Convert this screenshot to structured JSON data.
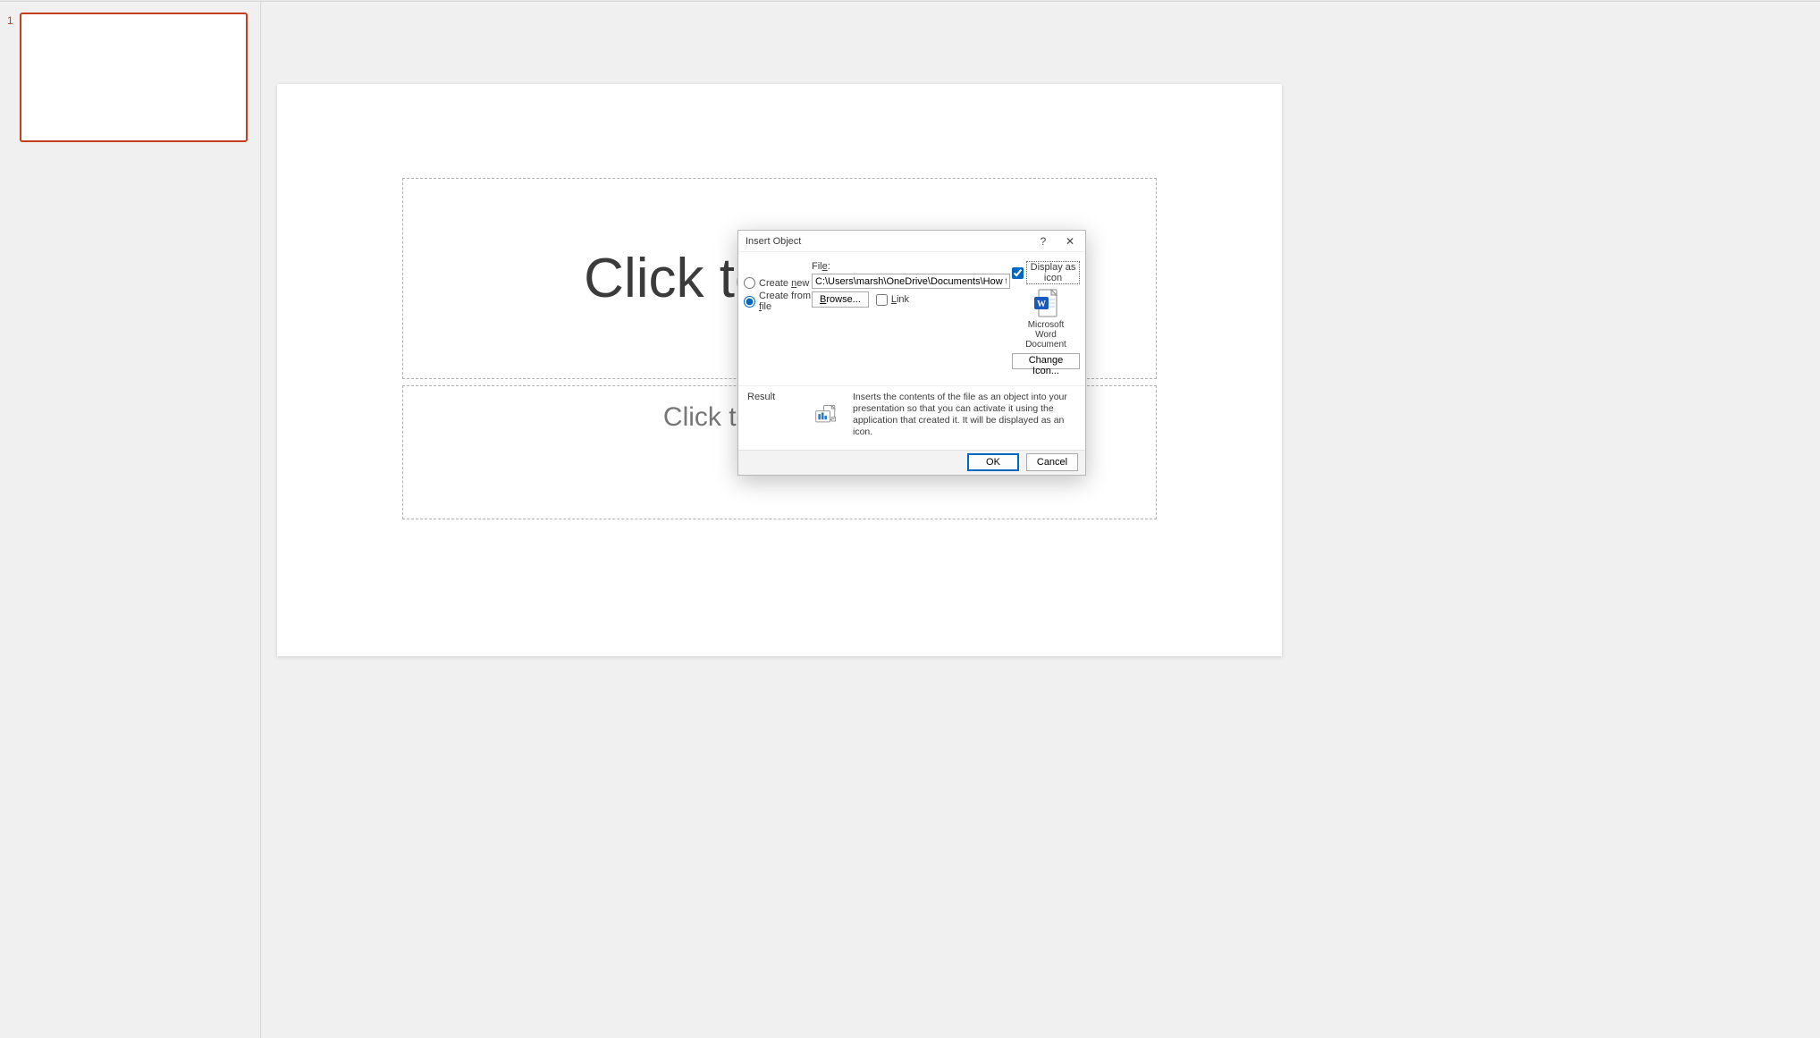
{
  "thumbnail": {
    "number": "1"
  },
  "slide": {
    "title_placeholder": "Click to add title",
    "subtitle_placeholder": "Click to add subtitle"
  },
  "dialog": {
    "title": "Insert Object",
    "help": "?",
    "close": "✕",
    "radio_new": "Create new",
    "radio_file": "Create from file",
    "file_label": "File:",
    "file_value": "C:\\Users\\marsh\\OneDrive\\Documents\\How to Share Your Mi",
    "browse": "Browse...",
    "link": "Link",
    "display_as_icon": "Display as icon",
    "icon_caption_line1": "Microsoft",
    "icon_caption_line2": "Word",
    "icon_caption_line3": "Document",
    "change_icon": "Change Icon...",
    "result_label": "Result",
    "result_text": "Inserts the contents of the file as an object into your presentation so that you can activate it using the application that created it. It will be displayed as an icon.",
    "ok": "OK",
    "cancel": "Cancel"
  }
}
